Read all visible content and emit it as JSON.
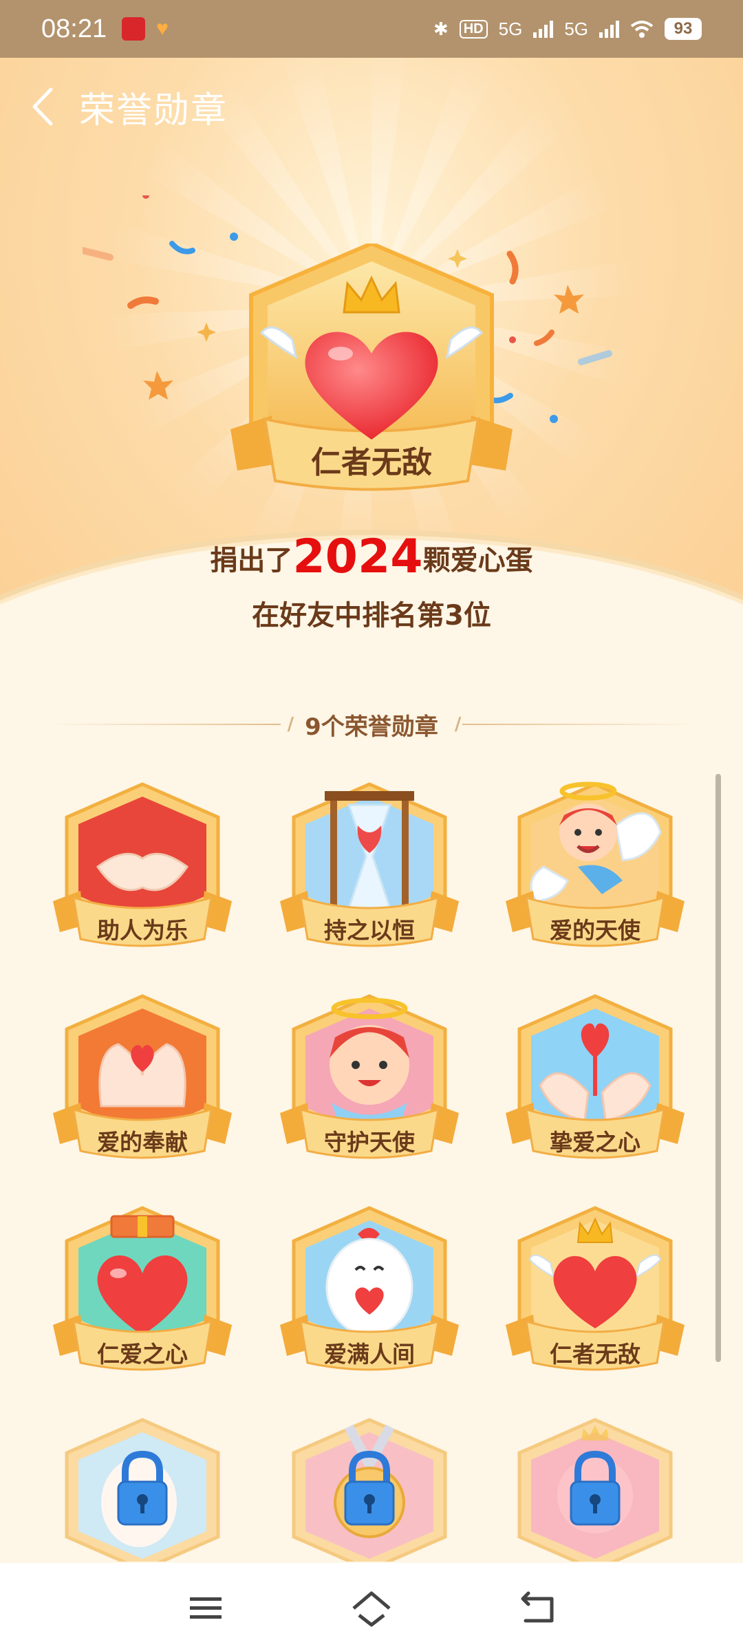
{
  "status_bar": {
    "time": "08:21",
    "network_1": "5G",
    "network_2": "5G",
    "hd_label": "HD",
    "battery": "93"
  },
  "header": {
    "title": "荣誉勋章",
    "back_icon": "chevron-left-icon"
  },
  "hero": {
    "badge_label": "仁者无敌",
    "donated_prefix": "捐出了",
    "donated_count": "2024",
    "donated_suffix": "颗爱心蛋",
    "rank_text": "在好友中排名第3位"
  },
  "section": {
    "title": "9个荣誉勋章"
  },
  "medals": [
    {
      "label": "助人为乐",
      "icon": "handshake-icon",
      "locked": false
    },
    {
      "label": "持之以恒",
      "icon": "hourglass-icon",
      "locked": false
    },
    {
      "label": "爱的天使",
      "icon": "angel-boy-icon",
      "locked": false
    },
    {
      "label": "爱的奉献",
      "icon": "heart-hands-icon",
      "locked": false
    },
    {
      "label": "守护天使",
      "icon": "halo-boy-icon",
      "locked": false
    },
    {
      "label": "挚爱之心",
      "icon": "hands-holding-heart-icon",
      "locked": false
    },
    {
      "label": "仁爱之心",
      "icon": "heart-gift-icon",
      "locked": false
    },
    {
      "label": "爱满人间",
      "icon": "chicken-heart-icon",
      "locked": false
    },
    {
      "label": "仁者无敌",
      "icon": "winged-heart-crown-icon",
      "locked": false
    },
    {
      "label": "",
      "icon": "lock-icon",
      "locked": true
    },
    {
      "label": "",
      "icon": "lock-icon",
      "locked": true
    },
    {
      "label": "",
      "icon": "lock-icon",
      "locked": true
    }
  ],
  "nav": {
    "menu_icon": "menu-icon",
    "home_icon": "home-icon",
    "back_icon": "back-arrow-icon"
  },
  "colors": {
    "status_bar_bg": "#b3936d",
    "accent_red": "#e60f0f",
    "label_brown": "#6a3a1a",
    "medal_gold": "#f7c56a"
  }
}
